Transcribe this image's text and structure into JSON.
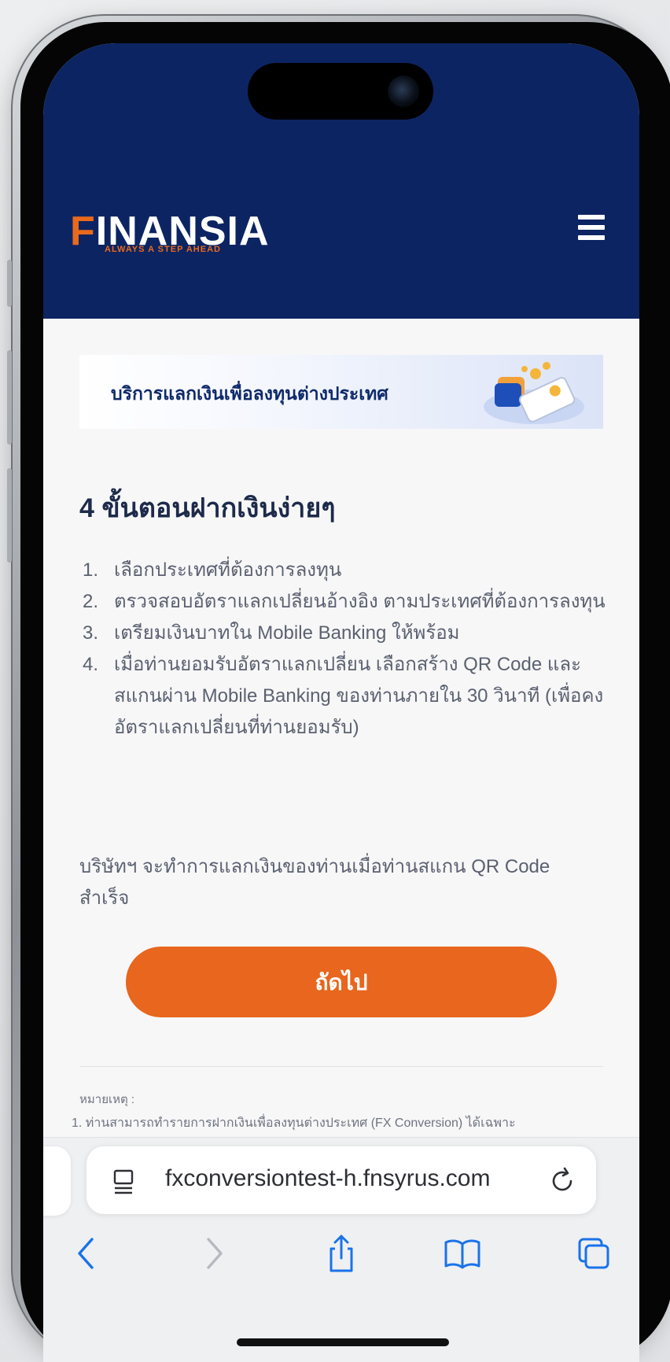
{
  "header": {
    "logo_text": "INANSIA",
    "logo_f": "F",
    "logo_tagline": "ALWAYS A STEP AHEAD",
    "menu_icon": "hamburger-icon",
    "bg_color": "#0c2462",
    "accent_color": "#e96a1c"
  },
  "banner": {
    "title": "บริการแลกเงินเพื่อลงทุนต่างประเทศ"
  },
  "content": {
    "title": "4 ขั้นตอนฝากเงินง่ายๆ",
    "steps": [
      {
        "num": "1.",
        "text": "เลือกประเทศที่ต้องการลงทุน"
      },
      {
        "num": "2.",
        "text": "ตรวจสอบอัตราแลกเปลี่ยนอ้างอิง ตามประเทศที่ต้องการลงทุน"
      },
      {
        "num": "3.",
        "text": "เตรียมเงินบาทใน Mobile Banking ให้พร้อม"
      },
      {
        "num": "4.",
        "text": "เมื่อท่านยอมรับอัตราแลกเปลี่ยน เลือกสร้าง QR Code และสแกนผ่าน Mobile Banking ของท่านภายใน 30 วินาที (เพื่อคงอัตราแลกเปลี่ยนที่ท่านยอมรับ)"
      }
    ],
    "note": "บริษัทฯ จะทำการแลกเงินของท่านเมื่อท่านสแกน QR Code สำเร็จ",
    "next_button": "ถัดไป",
    "button_color": "#e8661d",
    "remark_label": "หมายเหตุ :",
    "remark_1": "1.  ท่านสามารถทำรายการฝากเงินเพื่อลงทุนต่างประเทศ (FX Conversion) ได้เฉพาะ"
  },
  "browser": {
    "url": "fxconversiontest-h.fnsyrus.com",
    "icons": [
      "page-icon",
      "reload-icon",
      "back-icon",
      "forward-icon",
      "share-icon",
      "bookmarks-icon",
      "tabs-icon"
    ],
    "tint_color": "#1a73e8"
  }
}
